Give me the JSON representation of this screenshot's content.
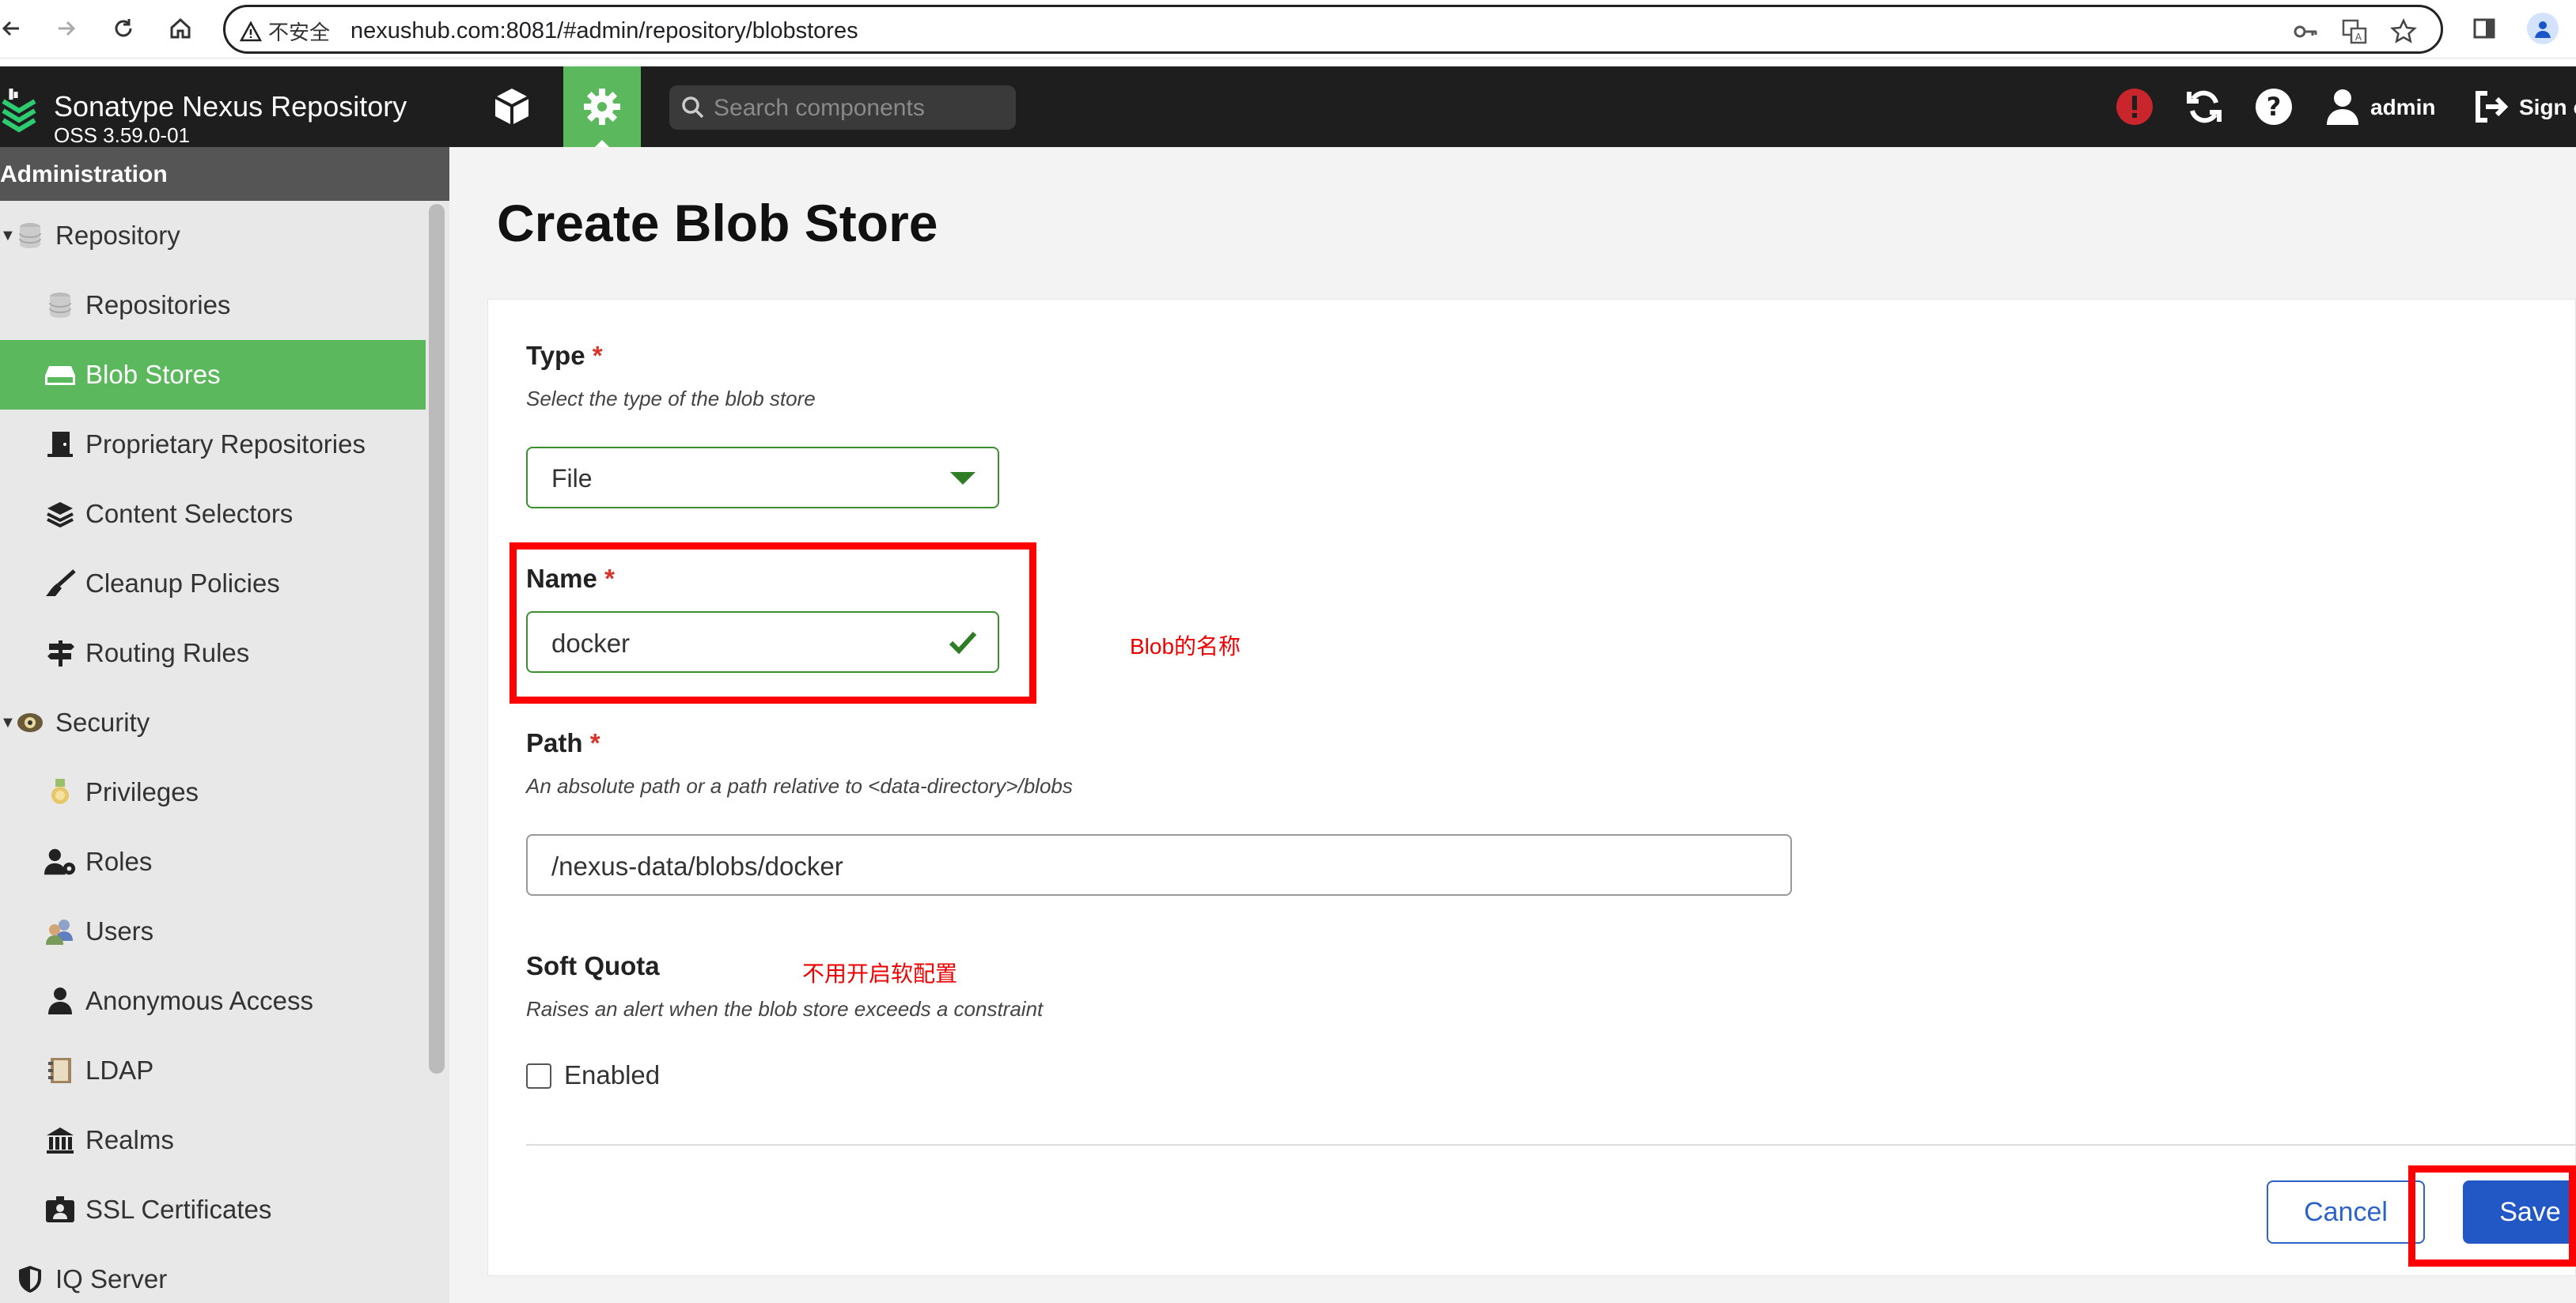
{
  "browser": {
    "security_label": "不安全",
    "url": "nexushub.com:8081/#admin/repository/blobstores"
  },
  "app": {
    "brand_title": "Sonatype Nexus Repository",
    "brand_version": "OSS 3.59.0-01",
    "search_placeholder": "Search components",
    "user": "admin",
    "sign_out": "Sign out"
  },
  "sidebar": {
    "header": "Administration",
    "items": [
      {
        "label": "Repository",
        "icon": "database-icon",
        "level": 0
      },
      {
        "label": "Repositories",
        "icon": "database-icon",
        "level": 1
      },
      {
        "label": "Blob Stores",
        "icon": "hard-drive-icon",
        "level": 1,
        "active": true
      },
      {
        "label": "Proprietary Repositories",
        "icon": "door-icon",
        "level": 1
      },
      {
        "label": "Content Selectors",
        "icon": "layers-icon",
        "level": 1
      },
      {
        "label": "Cleanup Policies",
        "icon": "broom-icon",
        "level": 1
      },
      {
        "label": "Routing Rules",
        "icon": "signpost-icon",
        "level": 1
      },
      {
        "label": "Security",
        "icon": "badge-icon",
        "level": 0
      },
      {
        "label": "Privileges",
        "icon": "medal-icon",
        "level": 1
      },
      {
        "label": "Roles",
        "icon": "user-gear-icon",
        "level": 1
      },
      {
        "label": "Users",
        "icon": "users-icon",
        "level": 1
      },
      {
        "label": "Anonymous Access",
        "icon": "user-icon",
        "level": 1
      },
      {
        "label": "LDAP",
        "icon": "address-book-icon",
        "level": 1
      },
      {
        "label": "Realms",
        "icon": "building-icon",
        "level": 1
      },
      {
        "label": "SSL Certificates",
        "icon": "id-card-icon",
        "level": 1
      },
      {
        "label": "IQ Server",
        "icon": "shield-icon",
        "level": 0
      }
    ]
  },
  "page": {
    "title": "Create Blob Store",
    "type_label": "Type",
    "type_help": "Select the type of the blob store",
    "type_value": "File",
    "name_label": "Name",
    "name_value": "docker",
    "path_label": "Path",
    "path_help": "An absolute path or a path relative to <data-directory>/blobs",
    "path_value": "/nexus-data/blobs/docker",
    "quota_label": "Soft Quota",
    "quota_help": "Raises an alert when the blob store exceeds a constraint",
    "quota_enabled_label": "Enabled",
    "cancel_label": "Cancel",
    "save_label": "Save",
    "required_mark": "*"
  },
  "annotations": {
    "name_note": "Blob的名称",
    "quota_note": "不用开启软配置"
  },
  "colors": {
    "accent_green": "#5cb85c",
    "primary_blue": "#2258c5",
    "annotation_red": "#ff0000"
  }
}
